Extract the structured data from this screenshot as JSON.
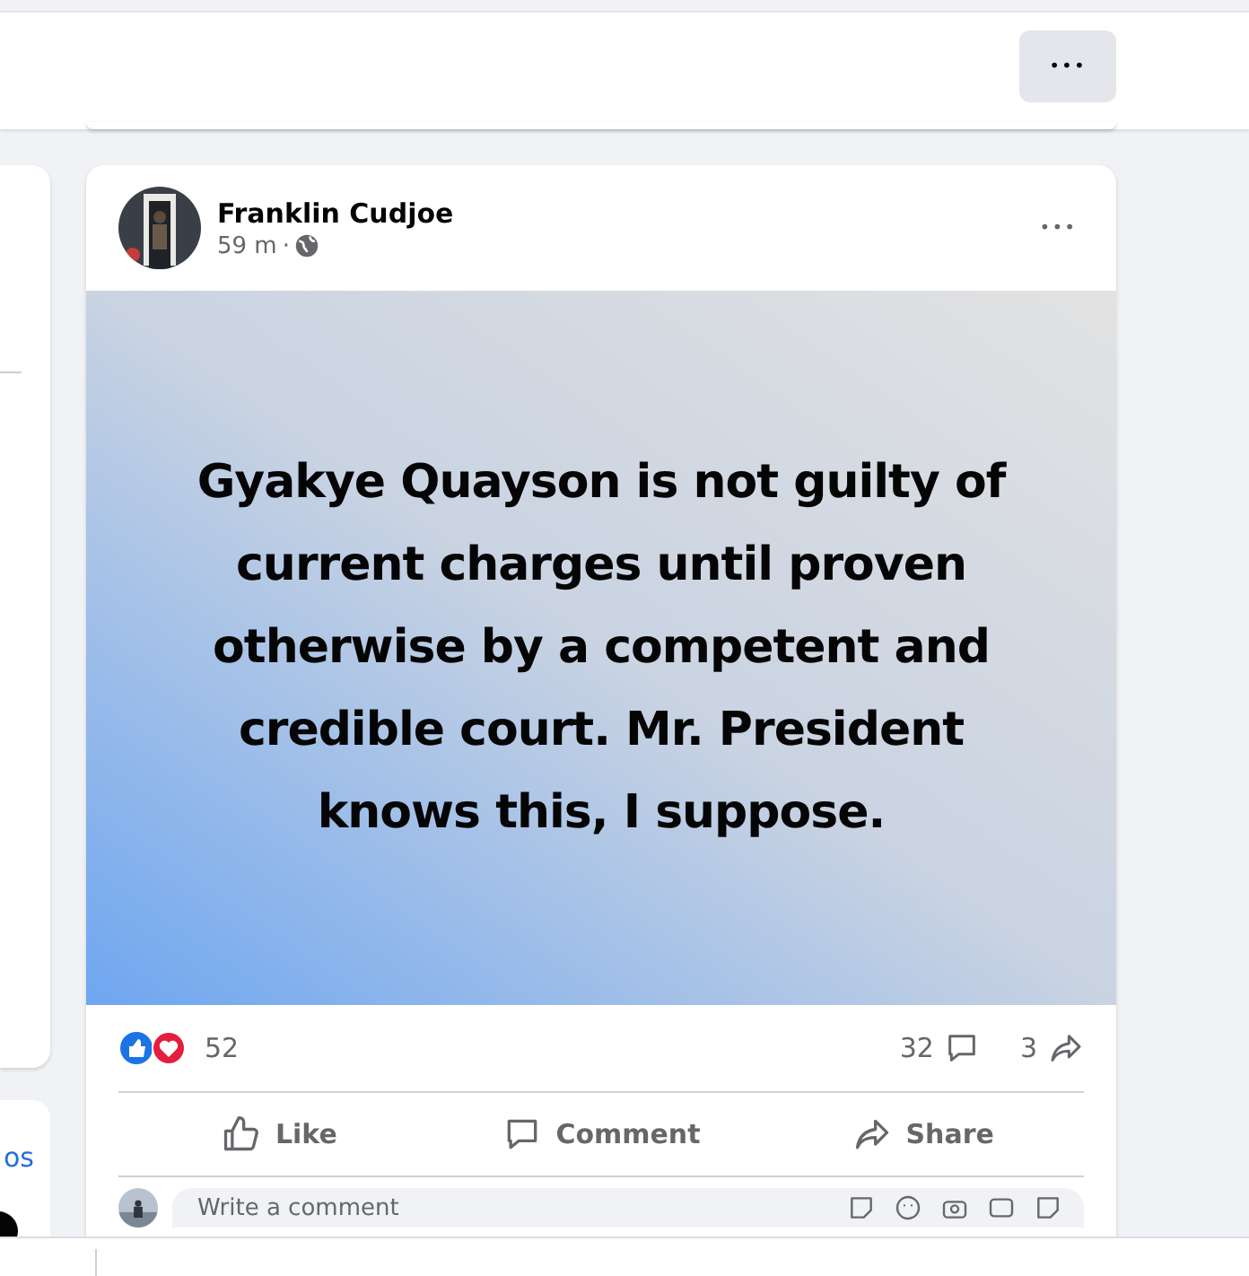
{
  "top_bar": {
    "more_button": "•••"
  },
  "left_column": {
    "link_text": "os"
  },
  "post": {
    "author": "Franklin Cudjoe",
    "time": "59 m",
    "separator": "·",
    "more_button": "•••",
    "text": "Gyakye Quayson is not guilty of current charges until proven otherwise by a competent and credible court. Mr. President knows this, I suppose.",
    "reaction_count": "52",
    "comment_count": "32",
    "share_count": "3",
    "actions": [
      {
        "kind": "like",
        "label": "Like"
      },
      {
        "kind": "comment",
        "label": "Comment"
      },
      {
        "kind": "share",
        "label": "Share"
      }
    ],
    "comment_field": {
      "placeholder": "Write a comment"
    }
  }
}
